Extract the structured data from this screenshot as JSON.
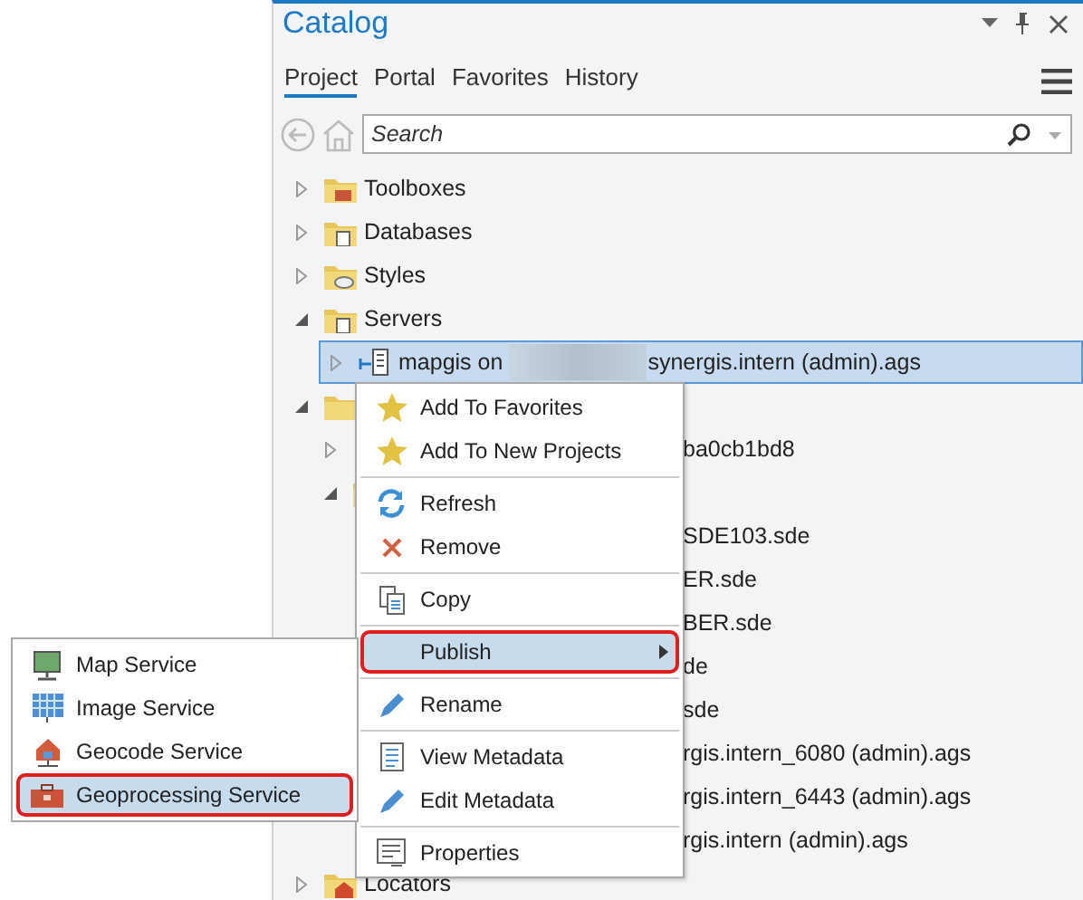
{
  "pane": {
    "title": "Catalog"
  },
  "tabs": [
    {
      "label": "Project",
      "selected": true
    },
    {
      "label": "Portal",
      "selected": false
    },
    {
      "label": "Favorites",
      "selected": false
    },
    {
      "label": "History",
      "selected": false
    }
  ],
  "search": {
    "placeholder": "Search"
  },
  "tree": [
    {
      "label": "Toolboxes",
      "kind": "toolbox",
      "expanded": false
    },
    {
      "label": "Databases",
      "kind": "database",
      "expanded": false
    },
    {
      "label": "Styles",
      "kind": "style",
      "expanded": false
    },
    {
      "label": "Servers",
      "kind": "server",
      "expanded": true,
      "children": [
        {
          "label": "mapgis on",
          "label_after": "synergis.intern (admin).ags",
          "redacted": true,
          "kind": "ags",
          "selected": true,
          "expanded": false
        }
      ]
    },
    {
      "kind": "folder",
      "expanded": true,
      "children": [
        {
          "label": "ba0cb1bd8",
          "partial": true,
          "expanded": false
        },
        {
          "kind": "folder",
          "expanded": true,
          "children": [
            {
              "label": "SDE103.sde",
              "partial": true
            },
            {
              "label": "ER.sde",
              "partial": true
            },
            {
              "label": "BER.sde",
              "partial": true
            },
            {
              "label": "de",
              "partial": true
            },
            {
              "label": "sde",
              "partial": true
            },
            {
              "label": "rgis.intern_6080 (admin).ags",
              "partial": true
            },
            {
              "label": "rgis.intern_6443 (admin).ags",
              "partial": true
            },
            {
              "label": "rgis.intern (admin).ags",
              "partial": true
            }
          ]
        }
      ]
    },
    {
      "label": "Locators",
      "kind": "locator",
      "expanded": false
    }
  ],
  "context_menu": [
    {
      "label": "Add To Favorites",
      "selected": false
    },
    {
      "label": "Add To New Projects",
      "selected": false
    },
    {
      "label": "Refresh",
      "selected": false,
      "separator_before": true
    },
    {
      "label": "Remove",
      "selected": false
    },
    {
      "label": "Copy",
      "selected": false,
      "separator_before": true
    },
    {
      "label": "Publish",
      "selected": true,
      "submenu": true,
      "outlined": true,
      "separator_before": true
    },
    {
      "label": "Rename",
      "selected": false,
      "separator_before": true
    },
    {
      "label": "View Metadata",
      "selected": false,
      "separator_before": true
    },
    {
      "label": "Edit Metadata",
      "selected": false
    },
    {
      "label": "Properties",
      "selected": false,
      "separator_before": true
    }
  ],
  "submenu": [
    {
      "label": "Map Service",
      "selected": false,
      "outlined": false
    },
    {
      "label": "Image Service",
      "selected": false,
      "outlined": false
    },
    {
      "label": "Geocode Service",
      "selected": false,
      "outlined": false
    },
    {
      "label": "Geoprocessing Service",
      "selected": true,
      "outlined": true
    }
  ]
}
